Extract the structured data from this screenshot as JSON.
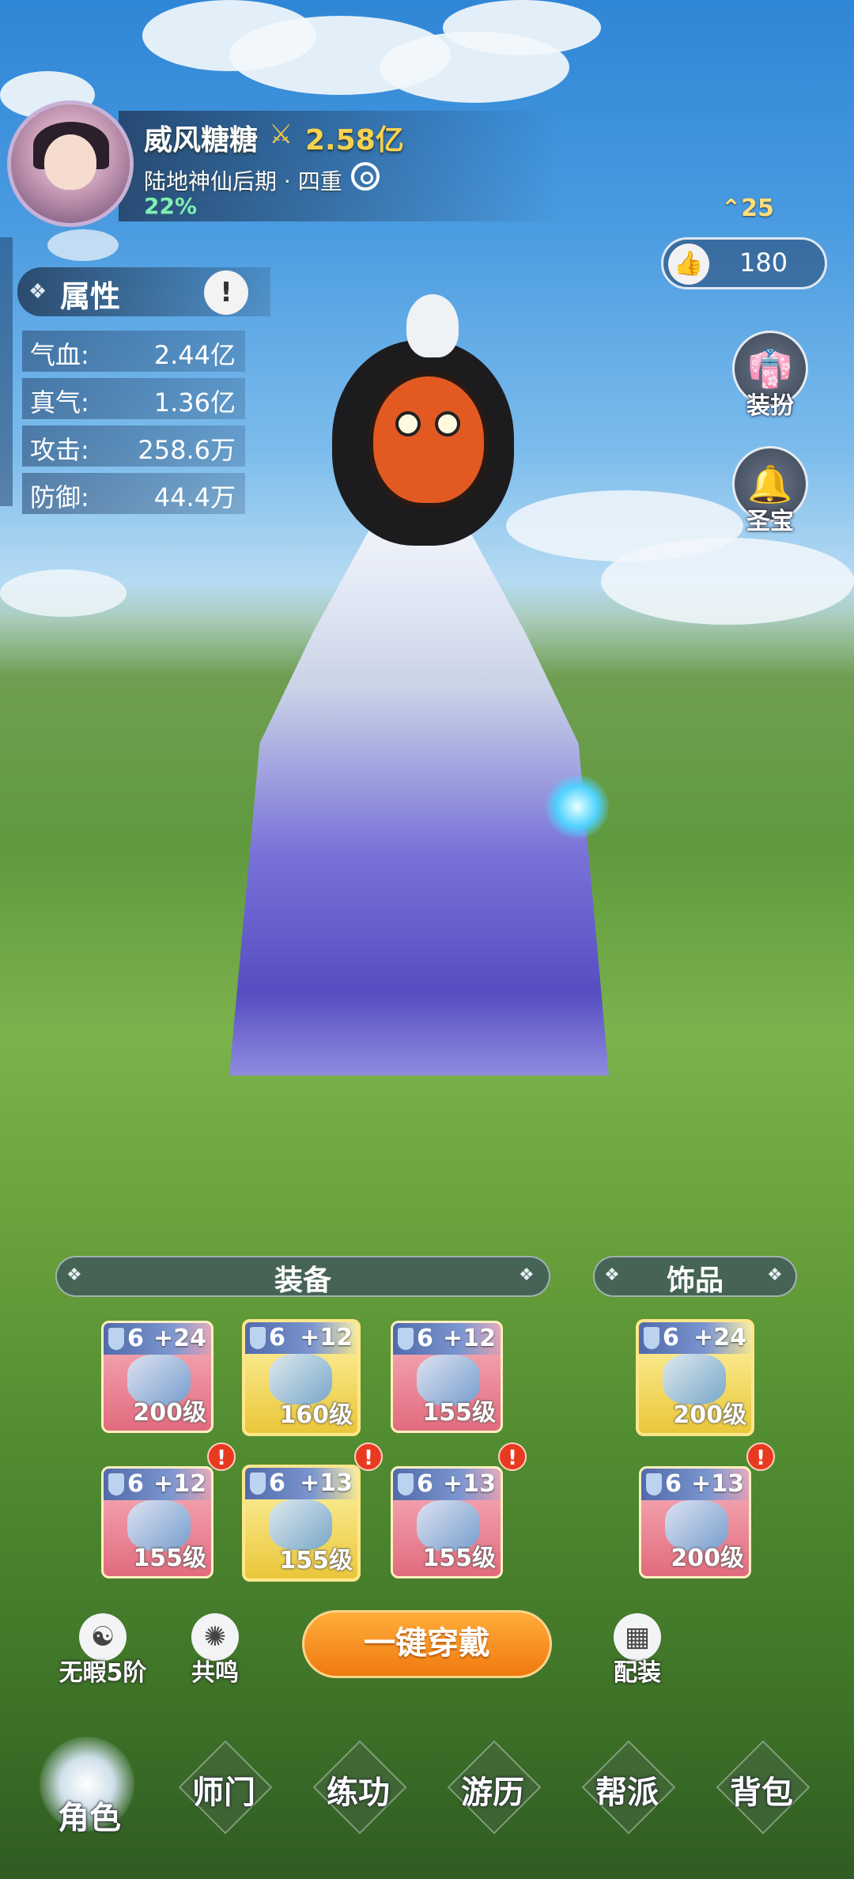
{
  "player": {
    "name": "威风糖糖",
    "power": "2.58亿",
    "realm": "陆地神仙后期 · 四重",
    "progress": "22%",
    "level": "25",
    "likes": "180"
  },
  "attributes": {
    "title": "属性",
    "info_icon": "!",
    "rows": [
      {
        "label": "气血:",
        "value": "2.44亿"
      },
      {
        "label": "真气:",
        "value": "1.36亿"
      },
      {
        "label": "攻击:",
        "value": "258.6万"
      },
      {
        "label": "防御:",
        "value": "44.4万"
      }
    ]
  },
  "side_buttons": [
    {
      "label": "装扮",
      "icon": "robe-icon"
    },
    {
      "label": "圣宝",
      "icon": "bell-icon"
    }
  ],
  "equipment": {
    "title": "装备",
    "slots": [
      {
        "grade": "6",
        "plus": "+24",
        "level": "200级",
        "rarity": "red",
        "alert": false
      },
      {
        "grade": "6",
        "plus": "+12",
        "level": "160级",
        "rarity": "gold",
        "alert": false
      },
      {
        "grade": "6",
        "plus": "+12",
        "level": "155级",
        "rarity": "red",
        "alert": false
      },
      {
        "grade": "6",
        "plus": "+12",
        "level": "155级",
        "rarity": "red",
        "alert": true
      },
      {
        "grade": "6",
        "plus": "+13",
        "level": "155级",
        "rarity": "gold",
        "alert": true
      },
      {
        "grade": "6",
        "plus": "+13",
        "level": "155级",
        "rarity": "red",
        "alert": true
      }
    ]
  },
  "accessories": {
    "title": "饰品",
    "slots": [
      {
        "grade": "6",
        "plus": "+24",
        "level": "200级",
        "rarity": "gold",
        "alert": false
      },
      {
        "grade": "6",
        "plus": "+13",
        "level": "200级",
        "rarity": "red",
        "alert": true
      }
    ]
  },
  "actions": {
    "flawless": "无暇5阶",
    "resonance": "共鸣",
    "equip_all": "一键穿戴",
    "loadout": "配装"
  },
  "nav": {
    "active": 0,
    "items": [
      "角色",
      "师门",
      "练功",
      "游历",
      "帮派",
      "背包"
    ]
  },
  "alert_glyph": "!",
  "colors": {
    "power_gold": "#f7d24e",
    "progress_green": "#7ff0b0",
    "button_orange": "#ef7a10",
    "alert_red": "#e83a20"
  }
}
